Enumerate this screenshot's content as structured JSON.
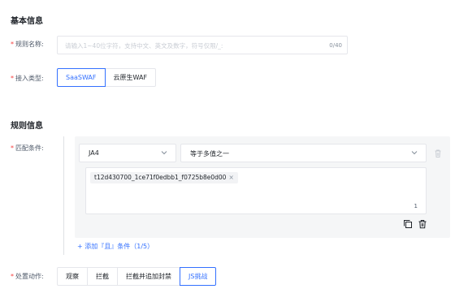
{
  "basic": {
    "title": "基本信息",
    "rule_name": {
      "label": "规则名称:",
      "placeholder": "请输入1~40位字符，支持中文、英文及数字，符号仅限/_:",
      "count": "0/40"
    },
    "access_type": {
      "label": "接入类型:",
      "options": [
        "SaaSWAF",
        "云原生WAF"
      ],
      "selected": "SaaSWAF"
    }
  },
  "rule": {
    "title": "规则信息",
    "match": {
      "label": "匹配条件:",
      "field_select": "JA4",
      "operator_select": "等于多值之一",
      "tags": [
        "t12d430700_1ce71f0edbb1_f0725b8e0d00"
      ],
      "tag_count": "1",
      "add_link": "+ 添加『且』条件（1/5）"
    },
    "action": {
      "label": "处置动作:",
      "options": [
        "观察",
        "拦截",
        "拦截并追加封禁",
        "JS挑战"
      ],
      "selected": "JS挑战"
    }
  },
  "colors": {
    "accent": "#3370ff",
    "required": "#f53f3f",
    "panel": "#f5f6f7"
  },
  "icons": [
    "chevron-down-icon",
    "trash-icon",
    "copy-icon",
    "delete-condition-icon",
    "tag-close-icon"
  ]
}
